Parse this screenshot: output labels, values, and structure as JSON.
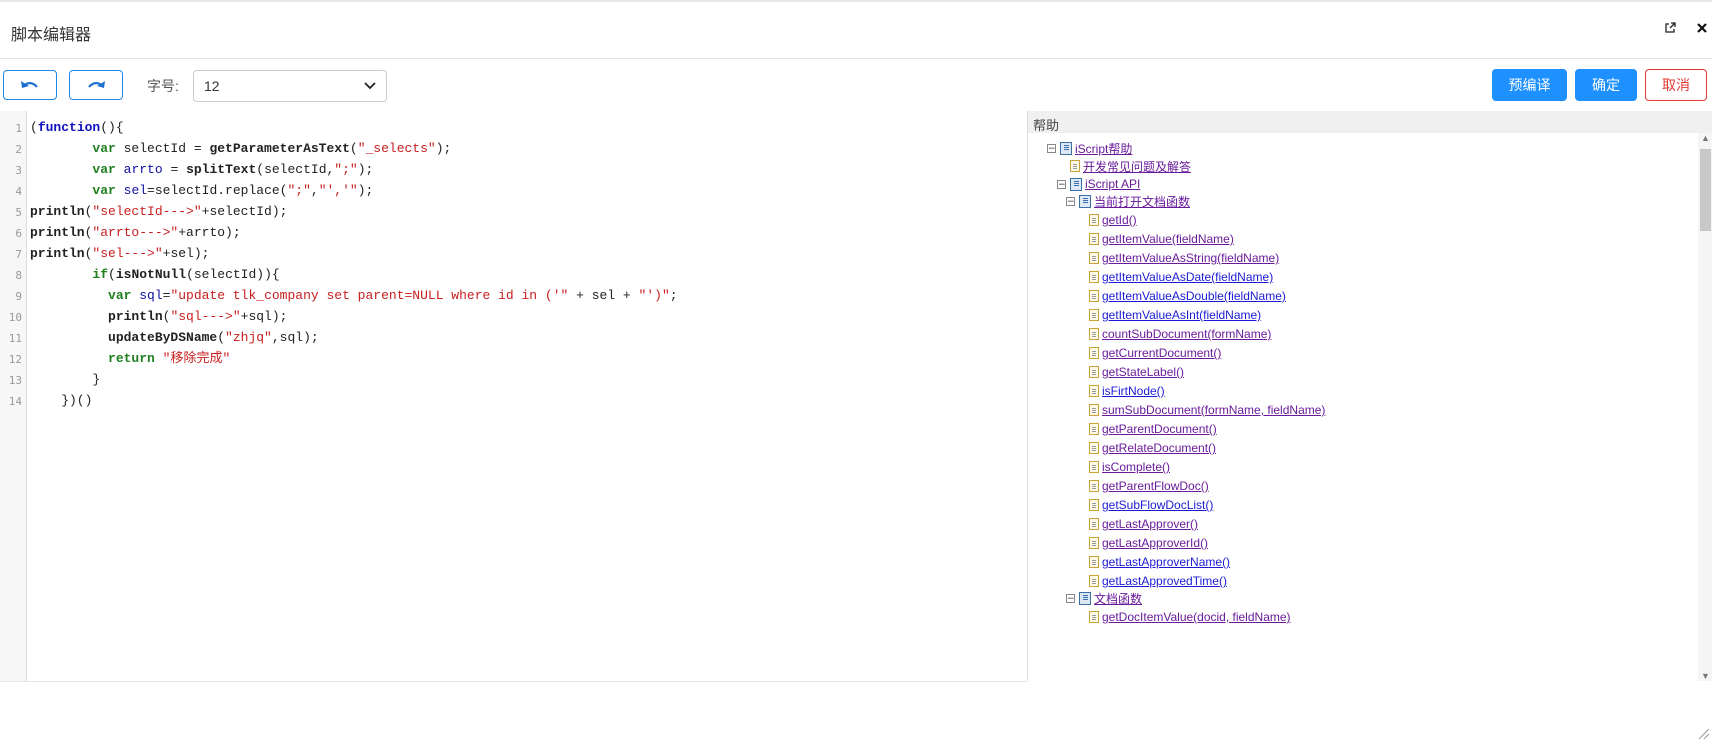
{
  "window": {
    "title": "脚本编辑器"
  },
  "toolbar": {
    "font_size_label": "字号:",
    "font_size_value": "12",
    "precompile_label": "预编译",
    "confirm_label": "确定",
    "cancel_label": "取消"
  },
  "code": {
    "line_numbers": [
      "1",
      "2",
      "3",
      "4",
      "5",
      "6",
      "7",
      "8",
      "9",
      "10",
      "11",
      "12",
      "13",
      "14"
    ]
  },
  "help": {
    "title": "帮助",
    "root_label": "iScript帮助",
    "faq_label": "开发常见问题及解答",
    "api_label": "iScript API",
    "group1_label": "当前打开文档函数",
    "group1_items": [
      "getId()",
      "getItemValue(fieldName)",
      "getItemValueAsString(fieldName)",
      "getItemValueAsDate(fieldName)",
      "getItemValueAsDouble(fieldName)",
      "getItemValueAsInt(fieldName)",
      "countSubDocument(formName)",
      "getCurrentDocument()",
      "getStateLabel()",
      "isFirtNode()",
      "sumSubDocument(formName, fieldName)",
      "getParentDocument()",
      "getRelateDocument()",
      "isComplete()",
      "getParentFlowDoc()",
      "getSubFlowDocList()",
      "getLastApprover()",
      "getLastApproverId()",
      "getLastApproverName()",
      "getLastApprovedTime()"
    ],
    "group2_label": "文档函数",
    "group2_items": [
      "getDocItemValue(docid, fieldName)"
    ]
  },
  "colors": {
    "accent": "#1e90ff",
    "danger": "#e53935"
  }
}
